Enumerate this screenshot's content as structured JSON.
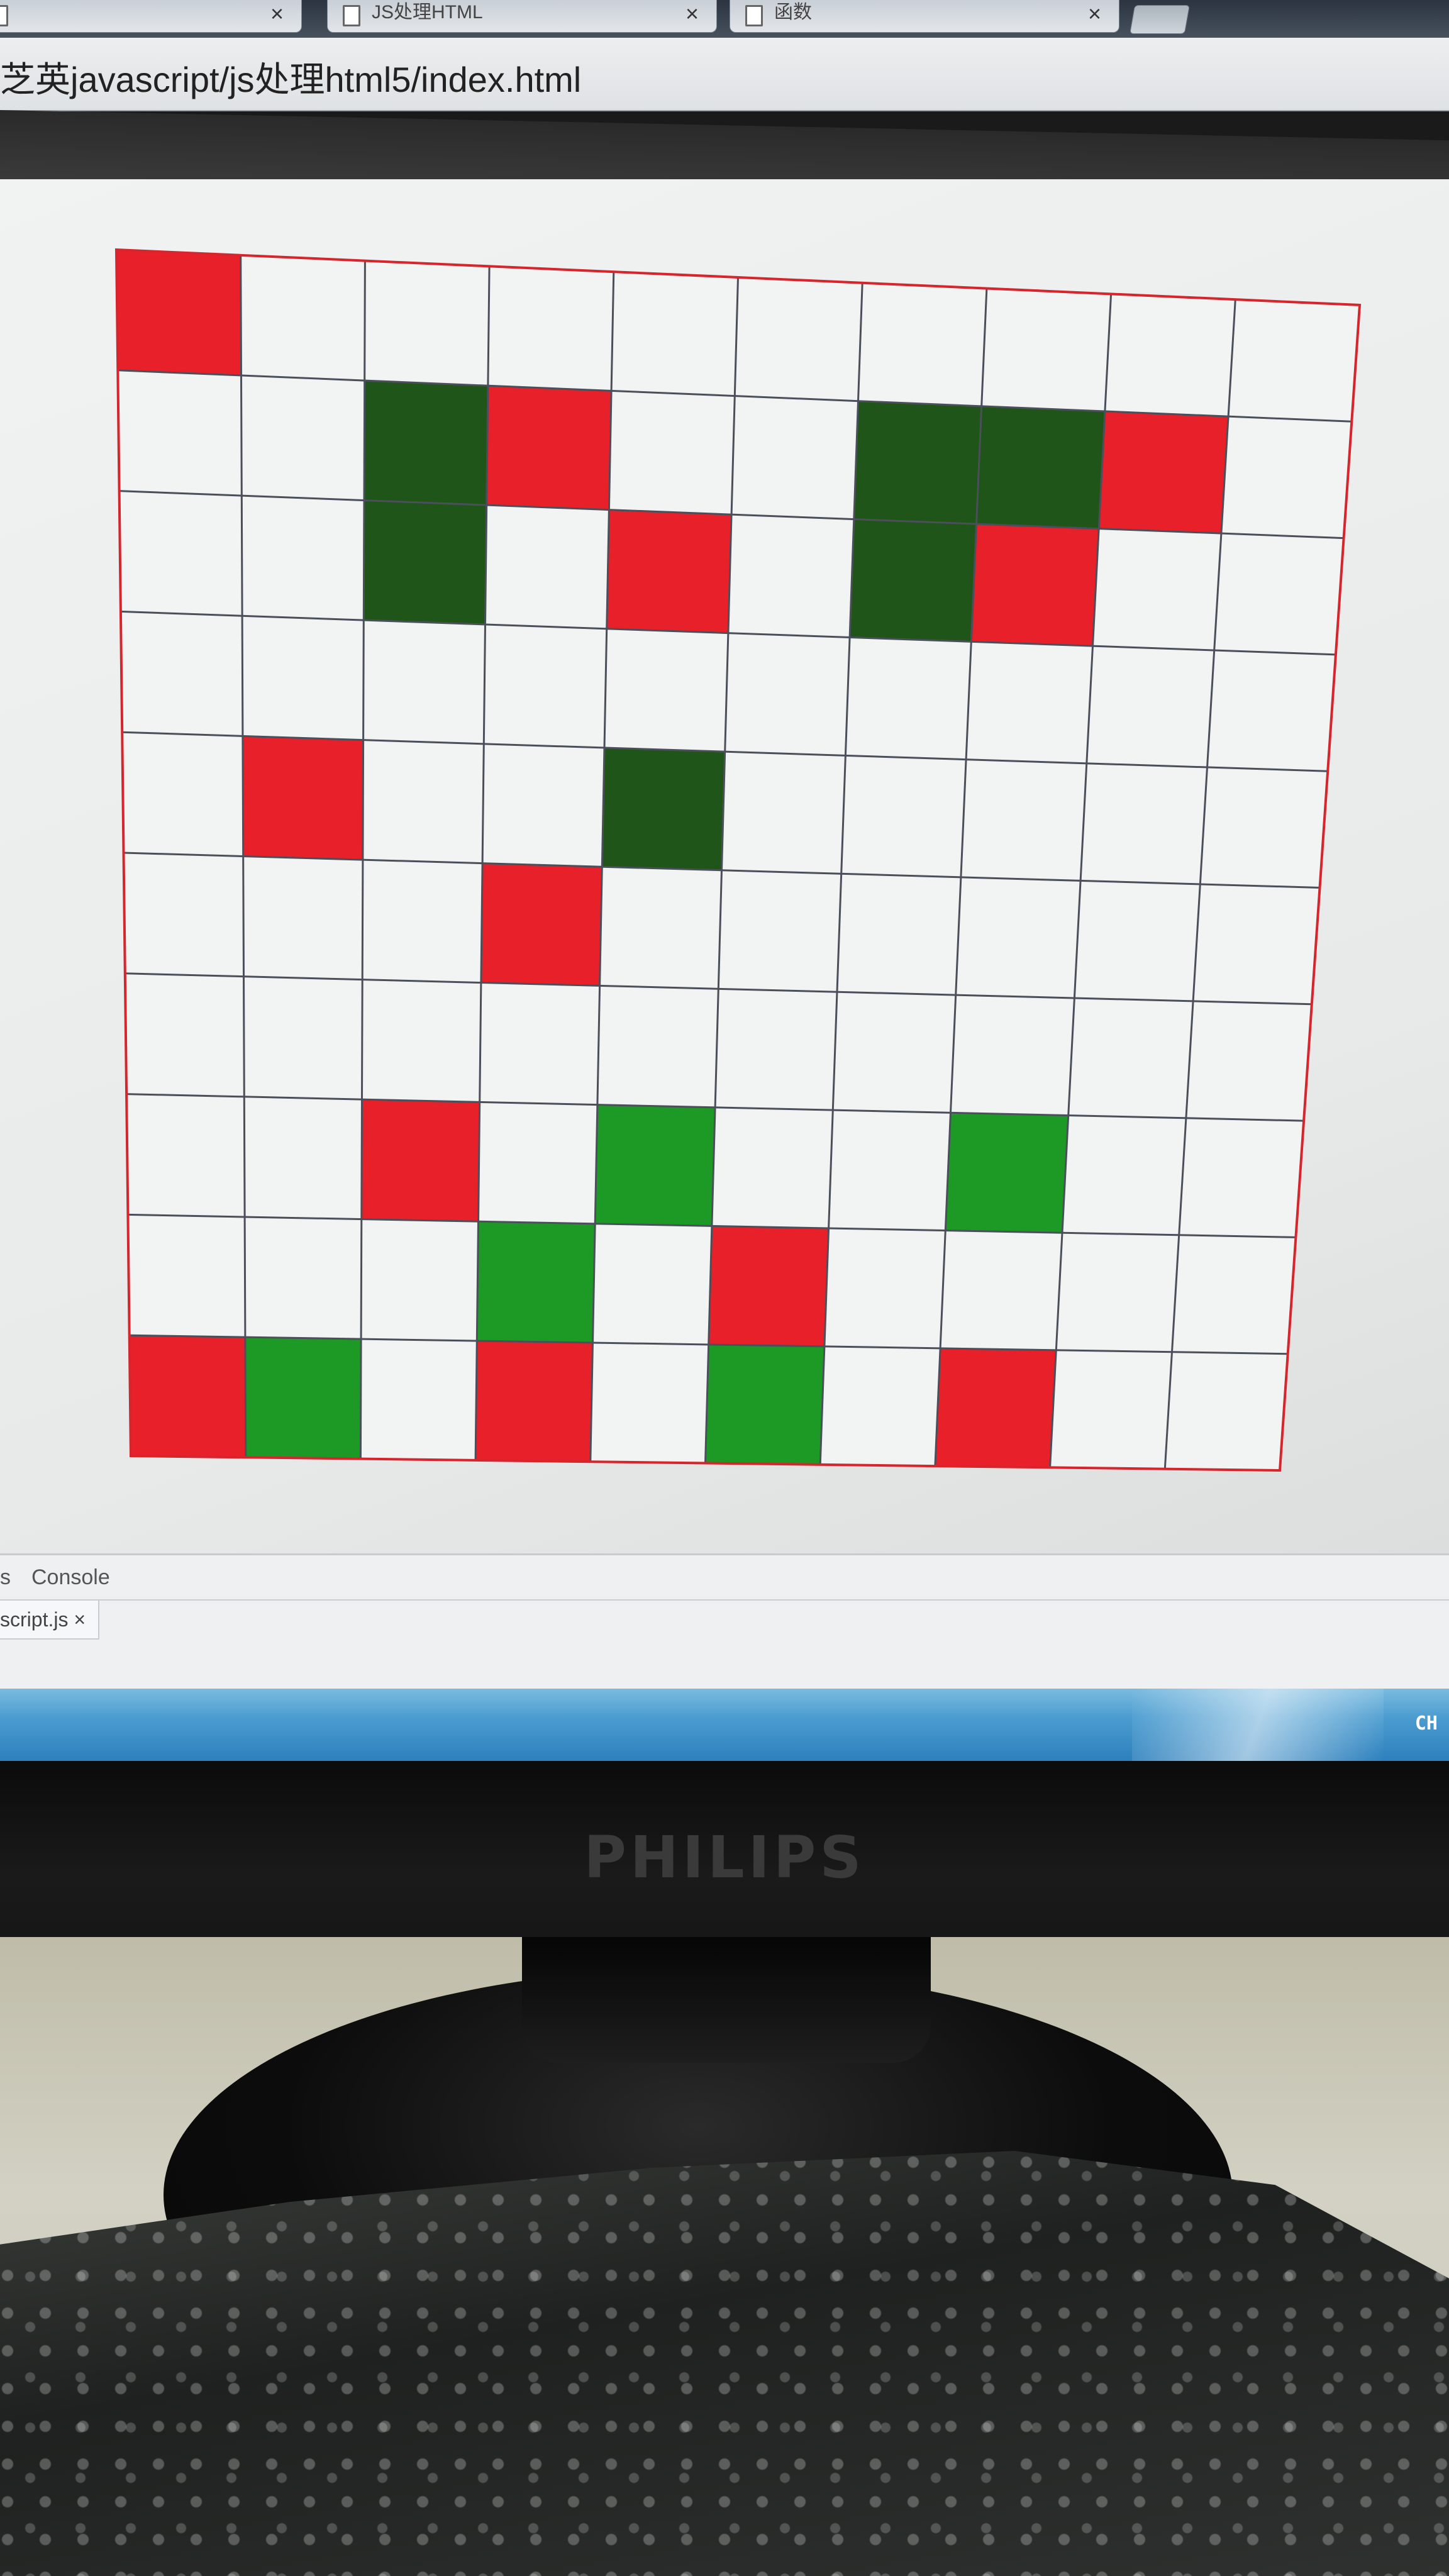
{
  "browser": {
    "tabs": [
      {
        "label": "",
        "close_glyph": "×"
      },
      {
        "label": "JS处理HTML",
        "close_glyph": "×"
      },
      {
        "label": "函数",
        "close_glyph": "×"
      }
    ],
    "address": "芝英javascript/js处理html5/index.html"
  },
  "grid": {
    "rows": 10,
    "cols": 10,
    "colors": {
      "red": "#e8202a",
      "dark_green": "#1f5518",
      "green": "#1d9a26",
      "cell": "#f2f4f4",
      "line": "#4a4f5a",
      "border": "#d7252e"
    },
    "cells": [
      [
        "red",
        "",
        "",
        "",
        "",
        "",
        "",
        "",
        "",
        ""
      ],
      [
        "",
        "",
        "dark_green",
        "red",
        "",
        "",
        "dark_green",
        "dark_green",
        "red",
        ""
      ],
      [
        "",
        "",
        "dark_green",
        "",
        "red",
        "",
        "dark_green",
        "red",
        "",
        ""
      ],
      [
        "",
        "",
        "",
        "",
        "",
        "",
        "",
        "",
        "",
        ""
      ],
      [
        "",
        "red",
        "",
        "",
        "dark_green",
        "",
        "",
        "",
        "",
        ""
      ],
      [
        "",
        "",
        "",
        "red",
        "",
        "",
        "",
        "",
        "",
        ""
      ],
      [
        "",
        "",
        "",
        "",
        "",
        "",
        "",
        "",
        "",
        ""
      ],
      [
        "",
        "",
        "red",
        "",
        "green",
        "",
        "",
        "green",
        "",
        ""
      ],
      [
        "",
        "",
        "",
        "green",
        "",
        "red",
        "",
        "",
        "",
        ""
      ],
      [
        "red",
        "green",
        "",
        "red",
        "",
        "green",
        "",
        "red",
        "",
        ""
      ]
    ]
  },
  "devtools": {
    "tab_partial": "s",
    "tab_console": "Console",
    "file_tab": "script.js ×"
  },
  "taskbar": {
    "language": "CH"
  },
  "monitor": {
    "brand": "PHILIPS"
  }
}
